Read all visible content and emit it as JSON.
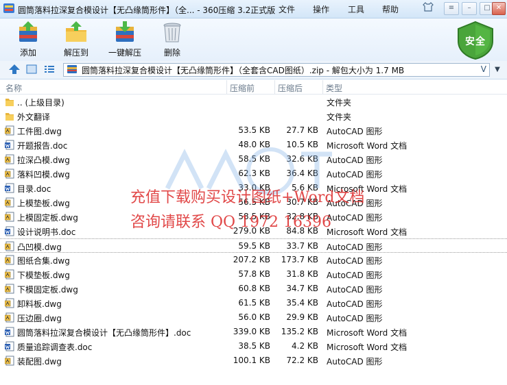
{
  "window": {
    "title": "圆筒落料拉深复合模设计【无凸缘筒形件】（全... - 360压缩 3.2正式版",
    "menus": [
      "文件",
      "操作",
      "工具",
      "帮助"
    ]
  },
  "toolbar": {
    "add": "添加",
    "extract_to": "解压到",
    "one_click_extract": "一键解压",
    "delete": "删除",
    "safe_badge": "安全"
  },
  "address": {
    "path": "圆筒落料拉深复合模设计【无凸缘筒形件】（全套含CAD图纸）.zip - 解包大小为 1.7 MB",
    "dropdown": "V"
  },
  "list": {
    "headers": {
      "name": "名称",
      "size": "压缩前",
      "compressed": "压缩后",
      "type": "类型"
    },
    "rows": [
      {
        "icon": "folder-up-icon",
        "name": ".. (上级目录)",
        "size": "",
        "compressed": "",
        "type": "文件夹"
      },
      {
        "icon": "folder-icon",
        "name": "外文翻译",
        "size": "",
        "compressed": "",
        "type": "文件夹"
      },
      {
        "icon": "dwg-file-icon",
        "name": "工件图.dwg",
        "size": "53.5 KB",
        "compressed": "27.7 KB",
        "type": "AutoCAD 图形"
      },
      {
        "icon": "doc-file-icon",
        "name": "开题报告.doc",
        "size": "48.0 KB",
        "compressed": "10.5 KB",
        "type": "Microsoft Word 文档"
      },
      {
        "icon": "dwg-file-icon",
        "name": "拉深凸模.dwg",
        "size": "58.5 KB",
        "compressed": "32.6 KB",
        "type": "AutoCAD 图形"
      },
      {
        "icon": "dwg-file-icon",
        "name": "落料凹模.dwg",
        "size": "62.3 KB",
        "compressed": "36.4 KB",
        "type": "AutoCAD 图形"
      },
      {
        "icon": "doc-file-icon",
        "name": "目录.doc",
        "size": "33.0 KB",
        "compressed": "5.6 KB",
        "type": "Microsoft Word 文档"
      },
      {
        "icon": "dwg-file-icon",
        "name": "上模垫板.dwg",
        "size": "56.5 KB",
        "compressed": "30.7 KB",
        "type": "AutoCAD 图形"
      },
      {
        "icon": "dwg-file-icon",
        "name": "上模固定板.dwg",
        "size": "58.5 KB",
        "compressed": "32.8 KB",
        "type": "AutoCAD 图形"
      },
      {
        "icon": "doc-file-icon",
        "name": "设计说明书.doc",
        "size": "279.0 KB",
        "compressed": "84.8 KB",
        "type": "Microsoft Word 文档"
      },
      {
        "icon": "dwg-file-icon",
        "name": "凸凹模.dwg",
        "size": "59.5 KB",
        "compressed": "33.7 KB",
        "type": "AutoCAD 图形"
      },
      {
        "icon": "dwg-file-icon",
        "name": "图纸合集.dwg",
        "size": "207.2 KB",
        "compressed": "173.7 KB",
        "type": "AutoCAD 图形"
      },
      {
        "icon": "dwg-file-icon",
        "name": "下模垫板.dwg",
        "size": "57.8 KB",
        "compressed": "31.8 KB",
        "type": "AutoCAD 图形"
      },
      {
        "icon": "dwg-file-icon",
        "name": "下模固定板.dwg",
        "size": "60.8 KB",
        "compressed": "34.7 KB",
        "type": "AutoCAD 图形"
      },
      {
        "icon": "dwg-file-icon",
        "name": "卸料板.dwg",
        "size": "61.5 KB",
        "compressed": "35.4 KB",
        "type": "AutoCAD 图形"
      },
      {
        "icon": "dwg-file-icon",
        "name": "压边圈.dwg",
        "size": "56.0 KB",
        "compressed": "29.9 KB",
        "type": "AutoCAD 图形"
      },
      {
        "icon": "doc-file-icon",
        "name": "圆筒落料拉深复合模设计【无凸缘筒形件】.doc",
        "size": "339.0 KB",
        "compressed": "135.2 KB",
        "type": "Microsoft Word 文档"
      },
      {
        "icon": "doc-file-icon",
        "name": "质量追踪调查表.doc",
        "size": "38.5 KB",
        "compressed": "4.2 KB",
        "type": "Microsoft Word 文档"
      },
      {
        "icon": "dwg-file-icon",
        "name": "装配图.dwg",
        "size": "100.1 KB",
        "compressed": "72.2 KB",
        "type": "AutoCAD 图形"
      }
    ]
  },
  "watermark": {
    "line1": "充值下载购买设计图纸+Word文档",
    "line2": "咨询请联系 QQ 1972 16396"
  },
  "colors": {
    "accent": "#2f78c4",
    "safe_green": "#4aa53b",
    "watermark_red": "#dc2828"
  }
}
